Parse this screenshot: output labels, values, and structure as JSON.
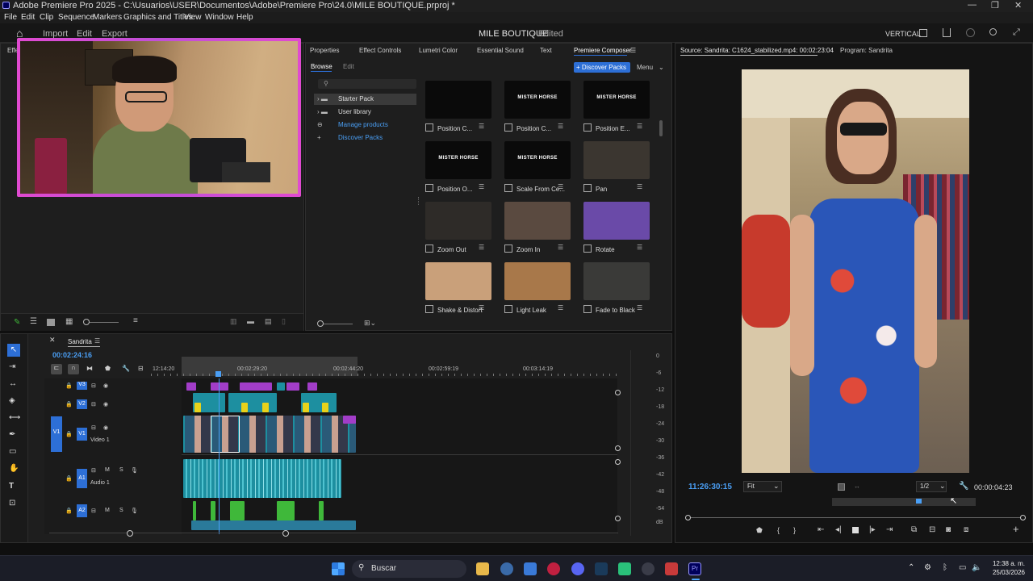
{
  "window": {
    "title": "Adobe Premiere Pro 2025 - C:\\Usuarios\\USER\\Documentos\\Adobe\\Premiere Pro\\24.0\\MILE BOUTIQUE.prproj *",
    "minimize": "—",
    "maximize": "❐",
    "close": "✕"
  },
  "menu": [
    "File",
    "Edit",
    "Clip",
    "Sequence",
    "Markers",
    "Graphics and Titles",
    "View",
    "Window",
    "Help"
  ],
  "appbar": {
    "home": "⌂",
    "tabs": [
      "Import",
      "Edit",
      "Export"
    ],
    "project": "MILE BOUTIQUE",
    "status": "- Edited",
    "workspace": "VERTICAL"
  },
  "left_panel": {
    "tab_stub": "Effe"
  },
  "center_panel": {
    "tabs": [
      "Properties",
      "Effect Controls",
      "Lumetri Color",
      "Essential Sound",
      "Text",
      "Premiere Composer"
    ],
    "subtabs": [
      "Browse",
      "Edit"
    ],
    "discover_button": "+ Discover Packs",
    "menu_button": "Menu",
    "tree": [
      {
        "label": "Starter Pack",
        "type": "folder",
        "link": false
      },
      {
        "label": "User library",
        "type": "folder",
        "link": false
      },
      {
        "label": "Manage products",
        "type": "box",
        "link": true
      },
      {
        "label": "Discover Packs",
        "type": "plus",
        "link": true
      }
    ],
    "thumbs": [
      {
        "label": "Position C...",
        "caption": "",
        "bg": "#0a0a0a"
      },
      {
        "label": "Position C...",
        "caption": "MISTER HORSE",
        "bg": "#0a0a0a"
      },
      {
        "label": "Position E...",
        "caption": "MISTER HORSE",
        "bg": "#0a0a0a"
      },
      {
        "label": "Position O...",
        "caption": "MISTER HORSE",
        "bg": "#0a0a0a"
      },
      {
        "label": "Scale From Ce...",
        "caption": "MISTER HORSE",
        "bg": "#0a0a0a"
      },
      {
        "label": "Pan",
        "caption": "",
        "bg": "#3b3630"
      },
      {
        "label": "Zoom Out",
        "caption": "",
        "bg": "#2e2b28"
      },
      {
        "label": "Zoom In",
        "caption": "",
        "bg": "#5a4a40"
      },
      {
        "label": "Rotate",
        "caption": "",
        "bg": "#6a4aa8"
      },
      {
        "label": "Shake & Distort",
        "caption": "",
        "bg": "#c9a07a"
      },
      {
        "label": "Light Leak",
        "caption": "",
        "bg": "#a8784a"
      },
      {
        "label": "Fade to Black",
        "caption": "",
        "bg": "#3a3a38"
      }
    ]
  },
  "right_panel": {
    "tabs": [
      "Source: Sandrita: C1624_stabilized.mp4: 00:02:23:04",
      "Program: Sandrita"
    ],
    "timecode": "11:26:30:15",
    "fit": "Fit",
    "resolution": "1/2",
    "duration": "00:00:04:23"
  },
  "timeline": {
    "sequence": "Sandrita",
    "timecode": "00:02:24:16",
    "ruler": [
      "12:14:20",
      "00:02:29:20",
      "00:02:44:20",
      "00:02:59:19",
      "00:03:14:19"
    ],
    "tracks": [
      {
        "id": "V3",
        "name": ""
      },
      {
        "id": "V2",
        "name": ""
      },
      {
        "id": "V1",
        "name": "Video 1"
      },
      {
        "id": "A1",
        "name": "Audio 1"
      },
      {
        "id": "A2",
        "name": ""
      }
    ],
    "meter_scale": [
      "0",
      "-6",
      "-12",
      "-18",
      "-24",
      "-30",
      "-36",
      "-42",
      "-48",
      "-54",
      "dB"
    ]
  },
  "taskbar": {
    "search": "Buscar",
    "time": "12:38 a. m.",
    "date": "25/03/2026"
  },
  "colors": {
    "accent_blue": "#2d6fd6",
    "clip_teal": "#1d8fa0",
    "clip_purple": "#a23dc8",
    "clip_yellow": "#e8d21a",
    "audio_green": "#3fb83a",
    "webcam_border": "#e04ad0"
  }
}
